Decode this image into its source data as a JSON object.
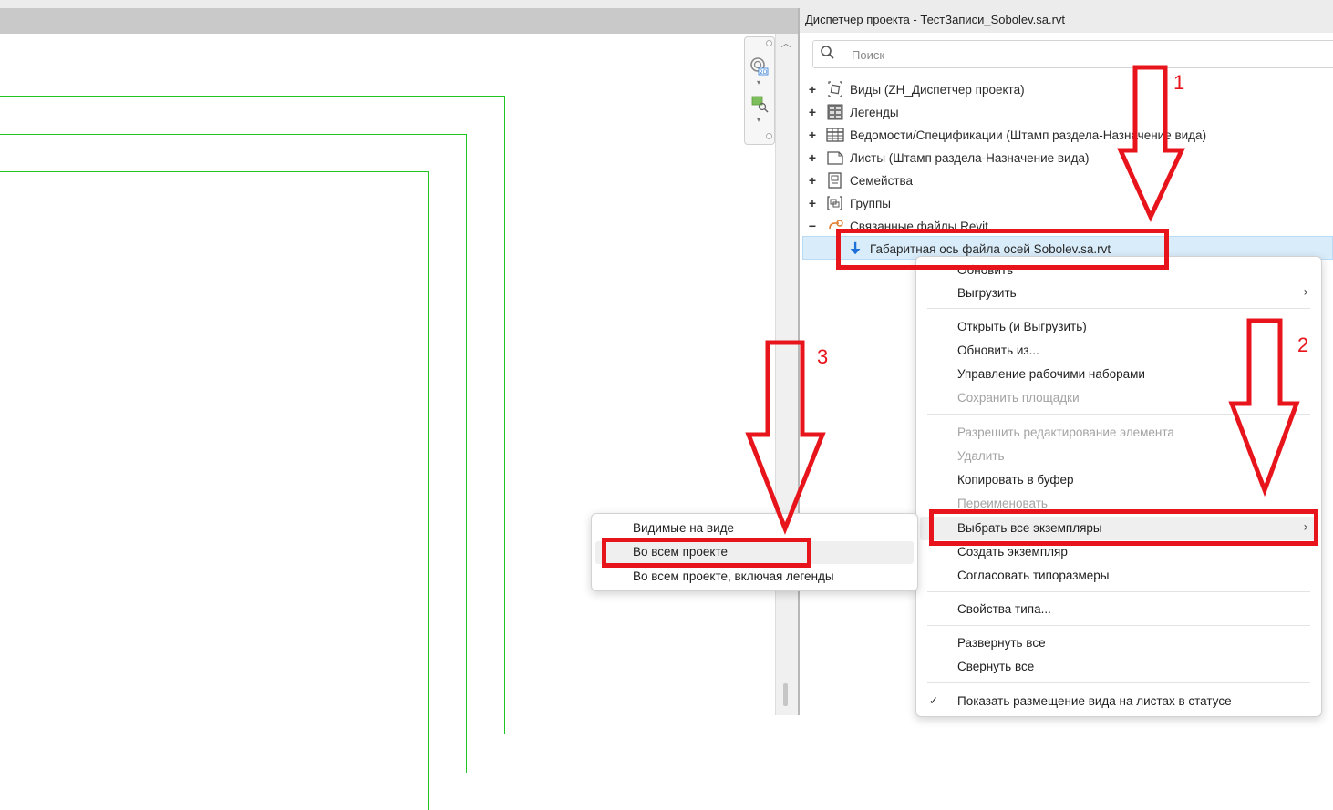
{
  "browser": {
    "title": "Диспетчер проекта - ТестЗаписи_Sobolev.sa.rvt",
    "search_placeholder": "Поиск",
    "tree": [
      {
        "expander": "+",
        "label": "Виды (ZH_Диспетчер проекта)",
        "icon": "views-icon"
      },
      {
        "expander": "+",
        "label": "Легенды",
        "icon": "legends-icon"
      },
      {
        "expander": "+",
        "label": "Ведомости/Спецификации (Штамп раздела-Назначение вида)",
        "icon": "schedules-icon"
      },
      {
        "expander": "+",
        "label": "Листы (Штамп раздела-Назначение вида)",
        "icon": "sheets-icon"
      },
      {
        "expander": "+",
        "label": "Семейства",
        "icon": "families-icon"
      },
      {
        "expander": "+",
        "label": "Группы",
        "icon": "groups-icon"
      },
      {
        "expander": "−",
        "label": "Связанные файлы Revit",
        "icon": "revit-links-icon"
      }
    ],
    "selected_item": "Габаритная ось файла осей Sobolev.sa.rvt"
  },
  "context_menu": {
    "items": [
      {
        "label": "Обновить",
        "enabled": true
      },
      {
        "label": "Выгрузить",
        "enabled": true,
        "submenu": true
      },
      {
        "label": "Открыть (и Выгрузить)",
        "enabled": true
      },
      {
        "label": "Обновить из...",
        "enabled": true
      },
      {
        "label": "Управление рабочими наборами",
        "enabled": true
      },
      {
        "label": "Сохранить площадки",
        "enabled": false
      },
      {
        "label": "Разрешить редактирование элемента",
        "enabled": false
      },
      {
        "label": "Удалить",
        "enabled": false
      },
      {
        "label": "Копировать в буфер",
        "enabled": true
      },
      {
        "label": "Переименовать",
        "enabled": false
      },
      {
        "label": "Выбрать все экземпляры",
        "enabled": true,
        "submenu": true,
        "highlighted": true
      },
      {
        "label": "Создать экземпляр",
        "enabled": true
      },
      {
        "label": "Согласовать типоразмеры",
        "enabled": true
      },
      {
        "label": "Свойства типа...",
        "enabled": true
      },
      {
        "label": "Развернуть все",
        "enabled": true
      },
      {
        "label": "Свернуть все",
        "enabled": true
      },
      {
        "label": "Показать размещение вида на листах в статусе",
        "enabled": true,
        "checked": true,
        "check_mark": "✓"
      }
    ]
  },
  "submenu": {
    "items": [
      {
        "label": "Видимые на виде"
      },
      {
        "label": "Во всем проекте",
        "highlighted": true
      },
      {
        "label": "Во всем проекте, включая легенды"
      }
    ]
  },
  "annotations": {
    "color": "#e8141c",
    "labels": [
      "1",
      "2",
      "3"
    ]
  },
  "colors": {
    "frame_green": "#22c422",
    "selection_bg": "#d9ecfa",
    "revit_link_arrow": "#1e6fd9"
  }
}
